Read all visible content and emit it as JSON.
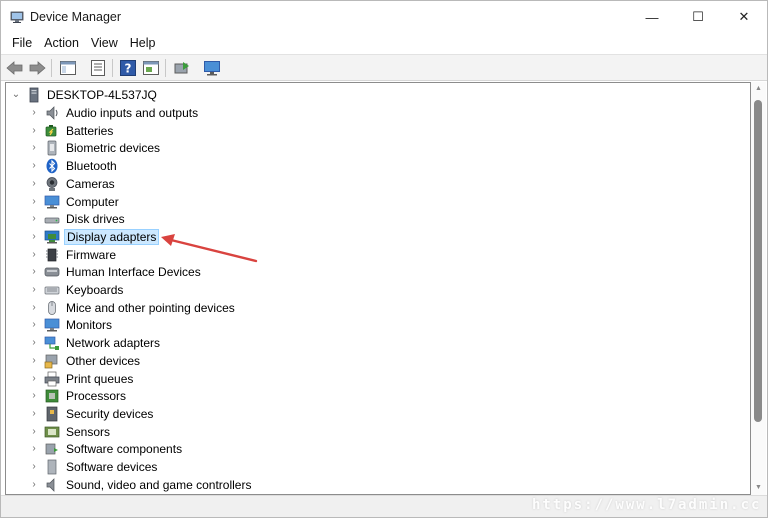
{
  "window": {
    "title": "Device Manager",
    "minimize_glyph": "—",
    "maximize_glyph": "☐",
    "close_glyph": "✕"
  },
  "menu": [
    "File",
    "Action",
    "View",
    "Help"
  ],
  "toolbar": {
    "buttons": [
      "back-icon",
      "forward-icon",
      "show-hide-console-tree-icon",
      "properties-icon",
      "help-icon",
      "action-pane-icon",
      "update-driver-icon",
      "monitor-scan-icon"
    ]
  },
  "tree": {
    "root": "DESKTOP-4L537JQ",
    "root_expander": "⌄",
    "child_expander": "›",
    "items": [
      {
        "label": "Audio inputs and outputs",
        "icon": "speaker-icon"
      },
      {
        "label": "Batteries",
        "icon": "battery-icon"
      },
      {
        "label": "Biometric devices",
        "icon": "biometric-icon"
      },
      {
        "label": "Bluetooth",
        "icon": "bluetooth-icon"
      },
      {
        "label": "Cameras",
        "icon": "camera-icon"
      },
      {
        "label": "Computer",
        "icon": "computer-icon"
      },
      {
        "label": "Disk drives",
        "icon": "disk-drive-icon"
      },
      {
        "label": "Display adapters",
        "icon": "display-adapter-icon",
        "selected": true
      },
      {
        "label": "Firmware",
        "icon": "firmware-icon"
      },
      {
        "label": "Human Interface Devices",
        "icon": "hid-icon"
      },
      {
        "label": "Keyboards",
        "icon": "keyboard-icon"
      },
      {
        "label": "Mice and other pointing devices",
        "icon": "mouse-icon"
      },
      {
        "label": "Monitors",
        "icon": "monitor-icon"
      },
      {
        "label": "Network adapters",
        "icon": "network-adapter-icon"
      },
      {
        "label": "Other devices",
        "icon": "other-devices-icon"
      },
      {
        "label": "Print queues",
        "icon": "printer-icon"
      },
      {
        "label": "Processors",
        "icon": "processor-icon"
      },
      {
        "label": "Security devices",
        "icon": "security-device-icon"
      },
      {
        "label": "Sensors",
        "icon": "sensor-icon"
      },
      {
        "label": "Software components",
        "icon": "software-component-icon"
      },
      {
        "label": "Software devices",
        "icon": "software-device-icon"
      },
      {
        "label": "Sound, video and game controllers",
        "icon": "sound-controller-icon"
      }
    ]
  },
  "colors": {
    "selection_bg": "#cce8ff",
    "selection_border": "#99d1ff",
    "annotation_arrow": "#d9433f"
  },
  "watermark": "https://www.l7admin.cc"
}
